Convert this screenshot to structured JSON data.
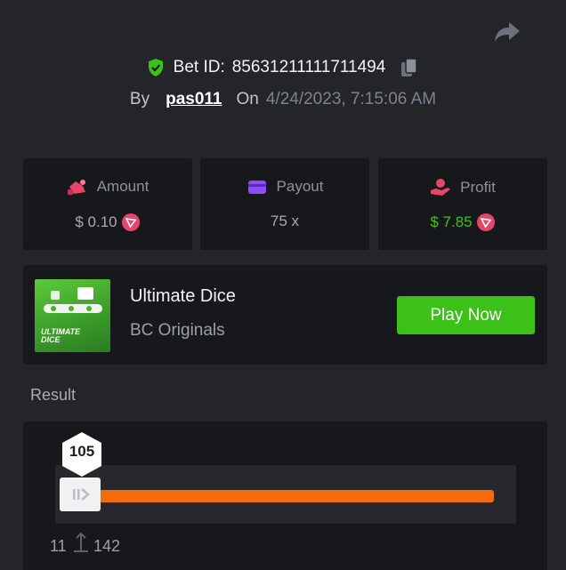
{
  "header": {
    "bet_id_label": "Bet ID:",
    "bet_id": "85631211111711494",
    "by_label": "By",
    "username": "pas011",
    "on_label": "On",
    "datetime": "4/24/2023, 7:15:06 AM"
  },
  "stats": {
    "amount": {
      "label": "Amount",
      "value": "$ 0.10",
      "icon": "money-bag-icon"
    },
    "payout": {
      "label": "Payout",
      "value": "75 x",
      "icon": "wallet-icon"
    },
    "profit": {
      "label": "Profit",
      "value": "$ 7.85",
      "icon": "hand-coin-icon"
    }
  },
  "game": {
    "title": "Ultimate Dice",
    "provider": "BC Originals",
    "play_label": "Play Now",
    "thumb_text_line1": "ULTIMATE",
    "thumb_text_line2": "DICE"
  },
  "result": {
    "title": "Result",
    "roll": "105",
    "range_min": "11",
    "range_max": "142"
  },
  "colors": {
    "background": "#232529",
    "card": "#17181b",
    "accent_green": "#3bc117",
    "slider_orange": "#f26b0d",
    "coin_pink": "#e8456b",
    "icon_purple": "#8c4dff"
  }
}
